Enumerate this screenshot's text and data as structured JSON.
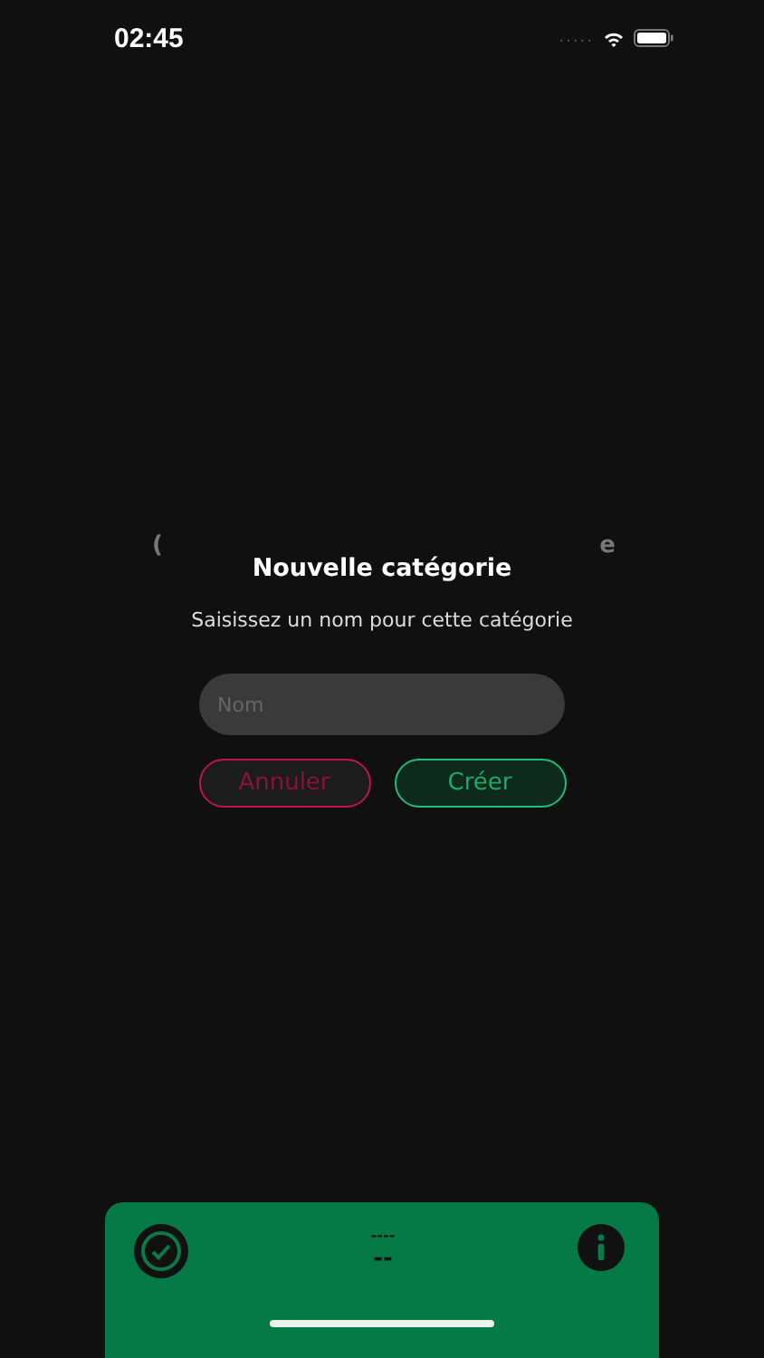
{
  "status_bar": {
    "time": "02:45",
    "signal": "....."
  },
  "background_fragments": [
    "(",
    "e"
  ],
  "dialog": {
    "title": "Nouvelle catégorie",
    "message": "Saisissez un nom pour cette catégorie",
    "field": {
      "placeholder": "Nom"
    },
    "buttons": [
      {
        "label": "Annuler",
        "kind": "cancel"
      },
      {
        "label": "Créer",
        "kind": "confirm"
      }
    ]
  },
  "bottom_panel": {
    "top_text": "----",
    "main_text": "--"
  }
}
